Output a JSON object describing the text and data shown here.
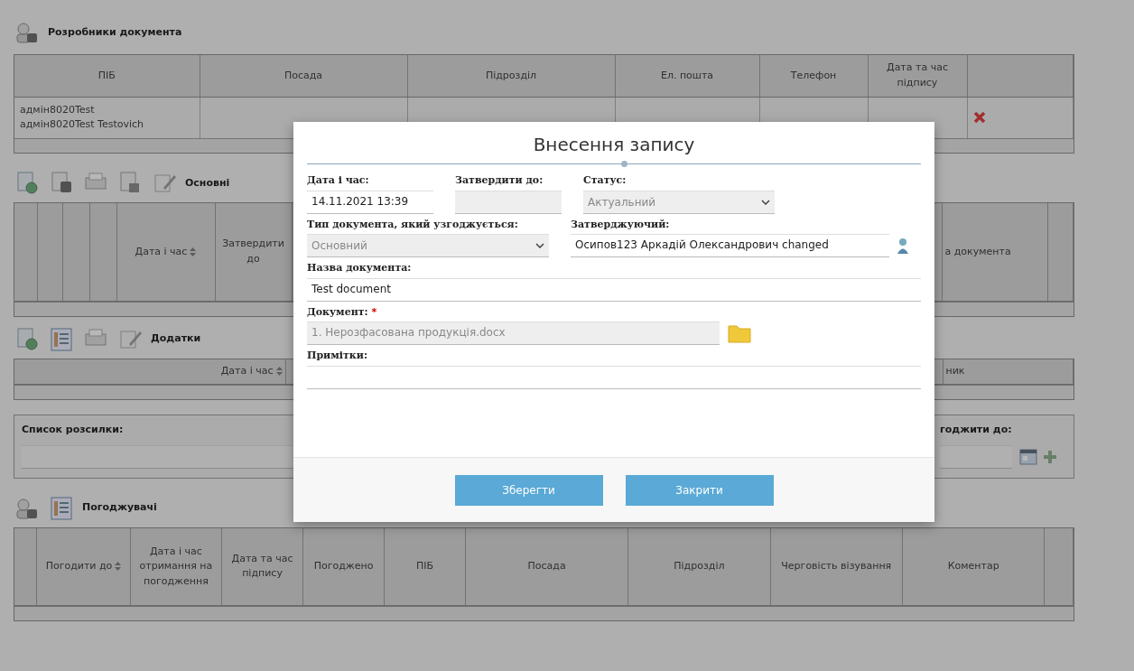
{
  "developers": {
    "title": "Розробники документа",
    "columns": [
      {
        "label": "ПІБ"
      },
      {
        "label": "Посада"
      },
      {
        "label": "Підрозділ"
      },
      {
        "label": "Ел. пошта"
      },
      {
        "label": "Телефон"
      },
      {
        "label": "Дата та час підпису"
      }
    ],
    "rows": [
      {
        "name_lines": [
          "адмін8020Test",
          "адмін8020Test Testovich"
        ]
      }
    ]
  },
  "main_docs": {
    "title": "Основні",
    "columns": [
      {
        "label": "Дата і час",
        "sortable": true
      },
      {
        "label": "Затвердити до"
      },
      {
        "label": "а документа"
      }
    ]
  },
  "attachments": {
    "title": "Додатки",
    "columns": [
      {
        "label": "Дата і час",
        "sortable": true
      },
      {
        "label": "ник"
      }
    ]
  },
  "mailing": {
    "label": "Список розсилки:",
    "approve_label": "годжити до:"
  },
  "approvers": {
    "title": "Погоджувачі",
    "columns": [
      {
        "label": "Погодити до",
        "sortable": true
      },
      {
        "label": "Дата і час отримання на погодження"
      },
      {
        "label": "Дата та час підпису"
      },
      {
        "label": "Погоджено"
      },
      {
        "label": "ПІБ"
      },
      {
        "label": "Посада"
      },
      {
        "label": "Підрозділ"
      },
      {
        "label": "Черговість візування"
      },
      {
        "label": "Коментар"
      }
    ]
  },
  "dialog": {
    "title": "Внесення запису",
    "date": {
      "label": "Дата і час:",
      "value": "14.11.2021 13:39",
      "disabled": false
    },
    "approve_until": {
      "label": "Затвердити до:",
      "disabled": true
    },
    "status": {
      "label": "Статус:",
      "value": "Актуальний",
      "disabled": true
    },
    "doc_type": {
      "label": "Тип документа, який узгоджується:",
      "value": "Основний",
      "disabled": true
    },
    "approver": {
      "label": "Затверджуючий:",
      "value": "Осипов123 Аркадій Олександрович changed",
      "disabled": false
    },
    "doc_name": {
      "label": "Назва документа:",
      "value": "Test document",
      "disabled": false
    },
    "document": {
      "label": "Документ:",
      "required": "*",
      "value": "1. Нерозфасована продукція.docx",
      "disabled": true
    },
    "notes": {
      "label": "Примітки:",
      "disabled": false
    },
    "buttons": [
      "Зберегти",
      "Закрити"
    ]
  }
}
